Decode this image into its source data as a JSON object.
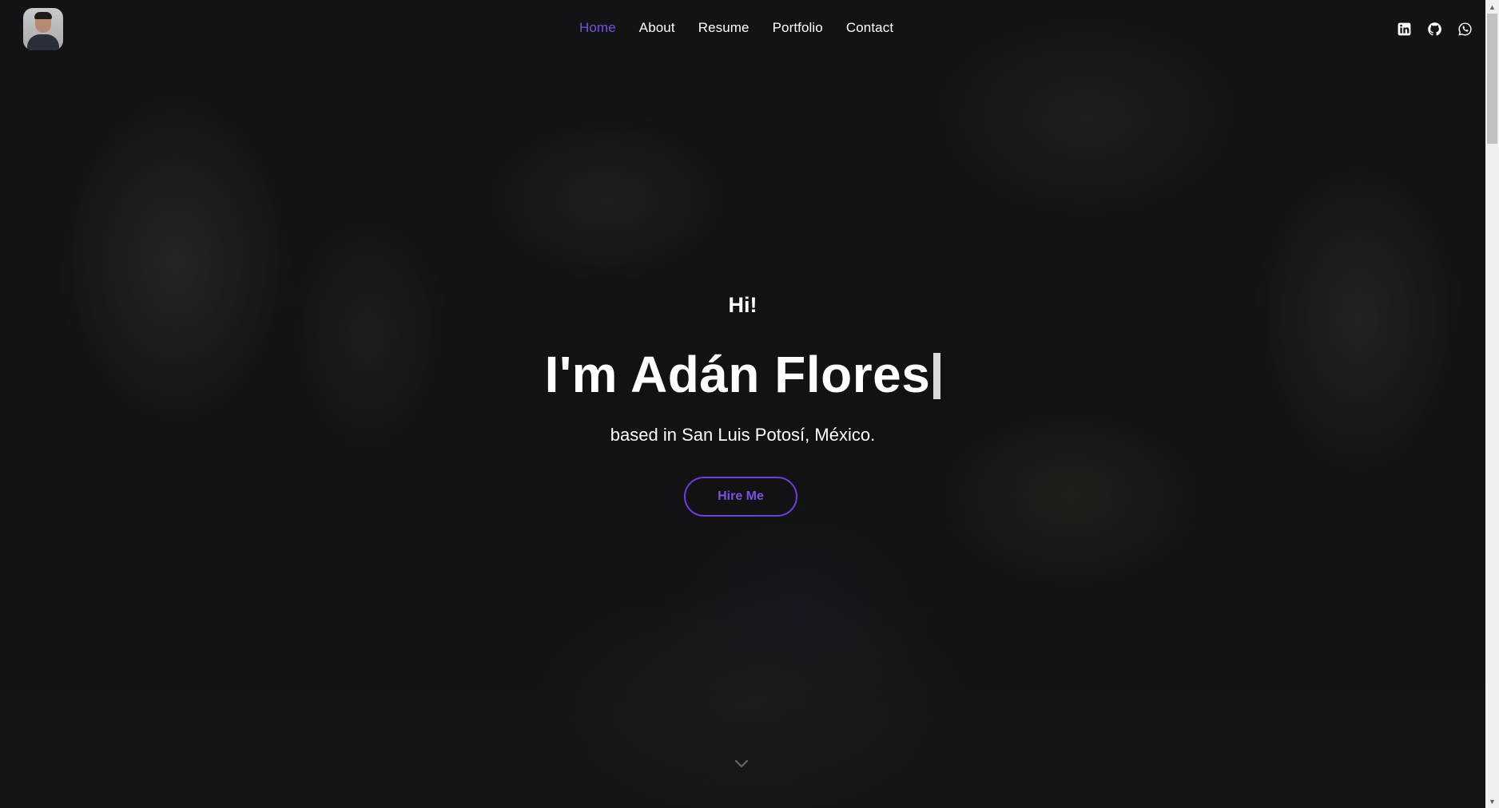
{
  "header": {
    "avatar_alt": "Adán Flores avatar",
    "nav": [
      {
        "label": "Home",
        "active": true
      },
      {
        "label": "About",
        "active": false
      },
      {
        "label": "Resume",
        "active": false
      },
      {
        "label": "Portfolio",
        "active": false
      },
      {
        "label": "Contact",
        "active": false
      }
    ],
    "social": [
      {
        "icon": "linkedin-icon"
      },
      {
        "icon": "github-icon"
      },
      {
        "icon": "whatsapp-icon"
      }
    ]
  },
  "hero": {
    "greeting": "Hi!",
    "title": "I'm Adán Flores",
    "subtitle": "based in San Luis Potosí, México.",
    "cta_label": "Hire Me"
  },
  "colors": {
    "accent": "#7b4fe0",
    "text": "#ffffff",
    "background": "#17181b"
  }
}
